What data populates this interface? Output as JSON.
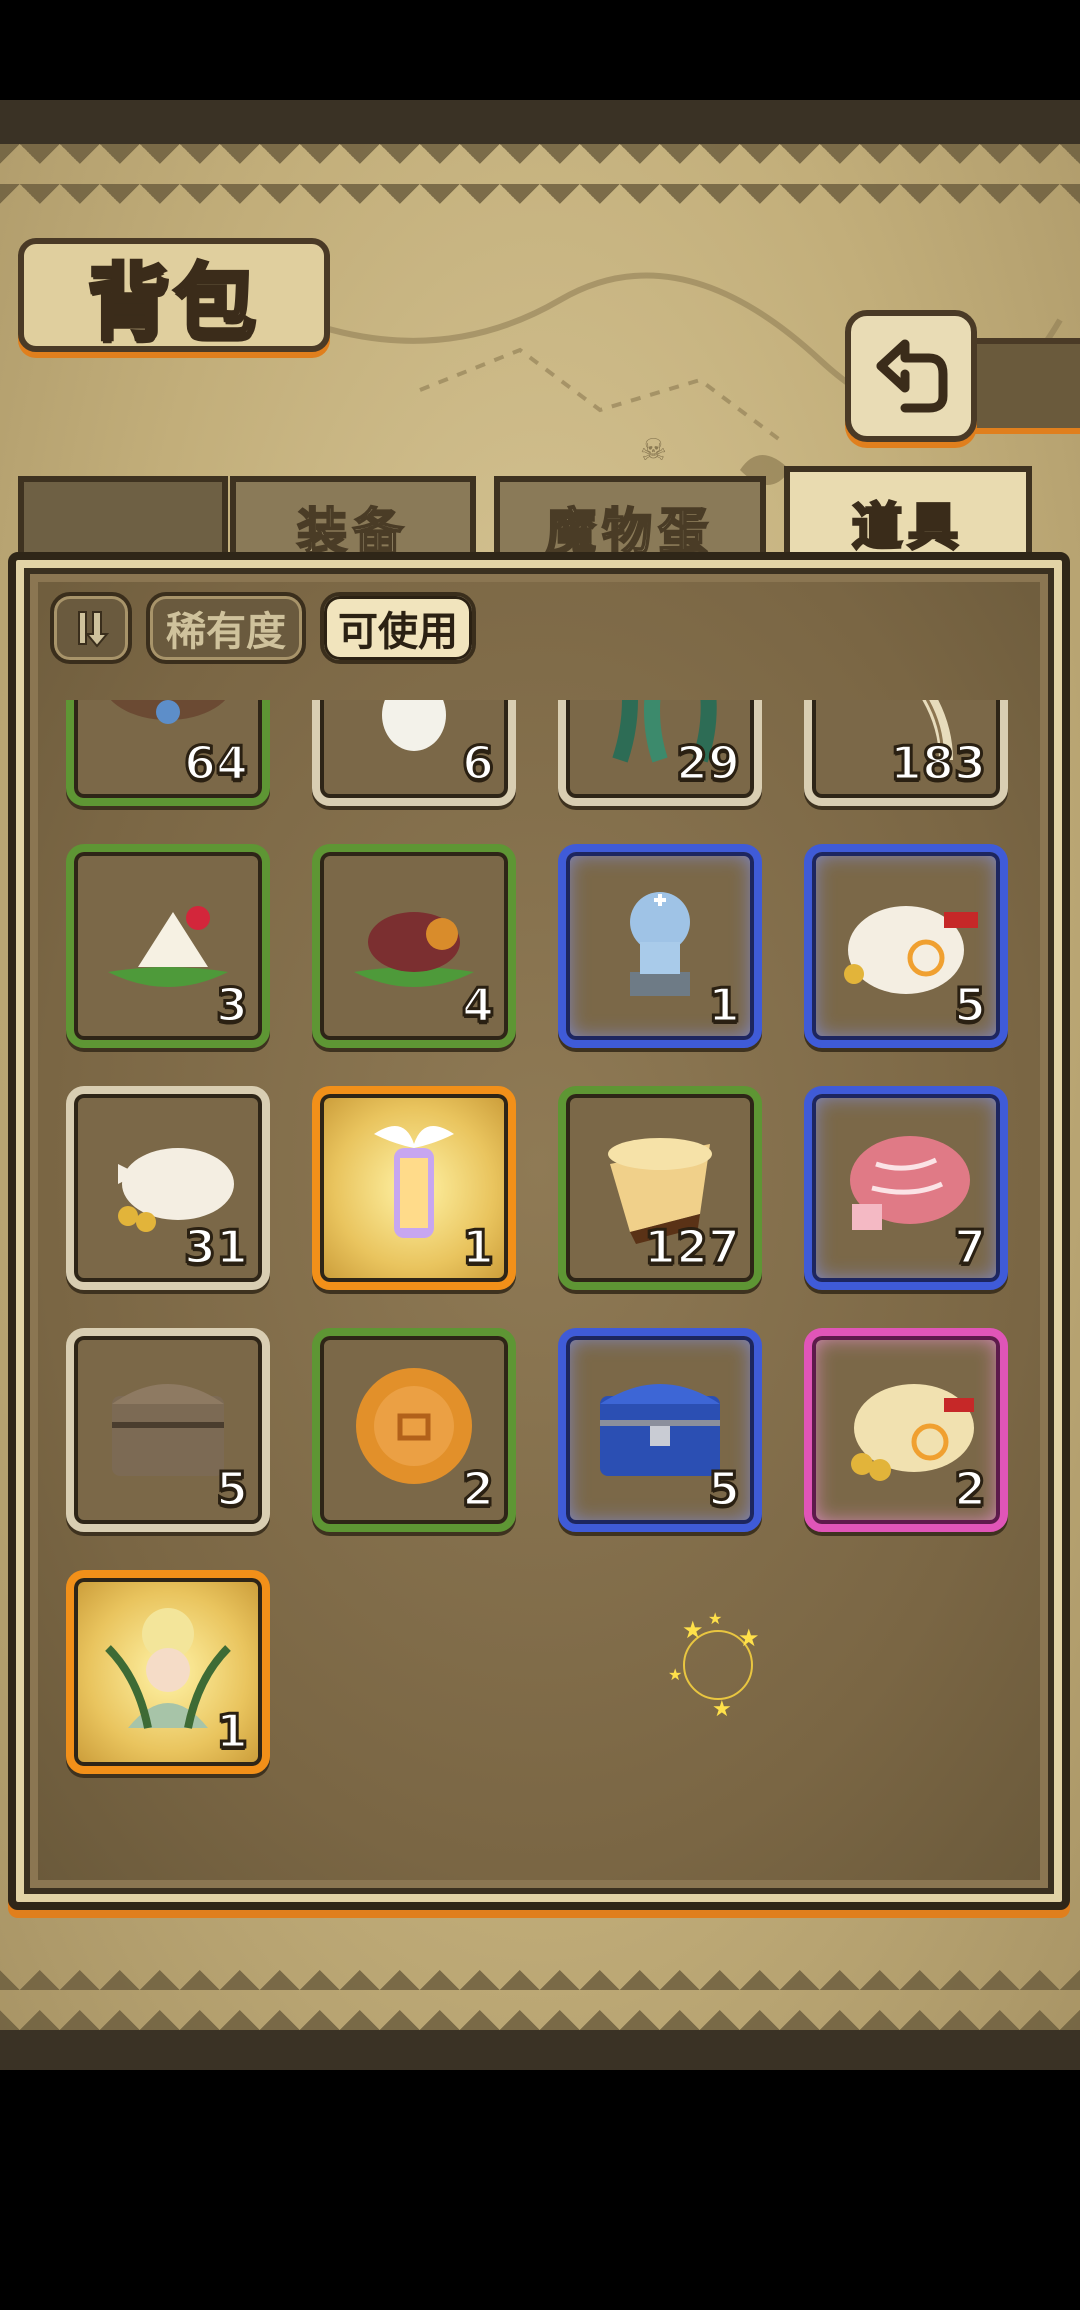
{
  "header": {
    "title": "背包"
  },
  "tabs": [
    {
      "label": "装备",
      "active": false
    },
    {
      "label": "魔物蛋",
      "active": false
    },
    {
      "label": "道具",
      "active": true
    }
  ],
  "filters": {
    "sort_icon": "sort-icon",
    "rarity_label": "稀有度",
    "usable_label": "可使用"
  },
  "items": [
    {
      "name": "paw-bowl",
      "qty": "64",
      "rarity": "green"
    },
    {
      "name": "radish",
      "qty": "6",
      "rarity": "white"
    },
    {
      "name": "seaweed",
      "qty": "29",
      "rarity": "white"
    },
    {
      "name": "quill-fish",
      "qty": "183",
      "rarity": "white"
    },
    {
      "name": "rice-dumpling",
      "qty": "3",
      "rarity": "green"
    },
    {
      "name": "sweet-potato",
      "qty": "4",
      "rarity": "green"
    },
    {
      "name": "knight-statue",
      "qty": "1",
      "rarity": "blue"
    },
    {
      "name": "swirl-coin-sack",
      "qty": "5",
      "rarity": "blue"
    },
    {
      "name": "coin-bag",
      "qty": "31",
      "rarity": "white"
    },
    {
      "name": "winged-lantern",
      "qty": "1",
      "rarity": "orange"
    },
    {
      "name": "pudding",
      "qty": "127",
      "rarity": "green"
    },
    {
      "name": "marbled-meat",
      "qty": "7",
      "rarity": "blue"
    },
    {
      "name": "wooden-chest",
      "qty": "5",
      "rarity": "white"
    },
    {
      "name": "mooncake",
      "qty": "2",
      "rarity": "green"
    },
    {
      "name": "blue-chest",
      "qty": "5",
      "rarity": "blue"
    },
    {
      "name": "big-coin-sack",
      "qty": "2",
      "rarity": "pink"
    },
    {
      "name": "flower-fairy",
      "qty": "1",
      "rarity": "orange"
    }
  ],
  "colors": {
    "accent_orange": "#e07f1d",
    "panel_brown": "#8b7652",
    "frame_dark": "#2f2618"
  }
}
